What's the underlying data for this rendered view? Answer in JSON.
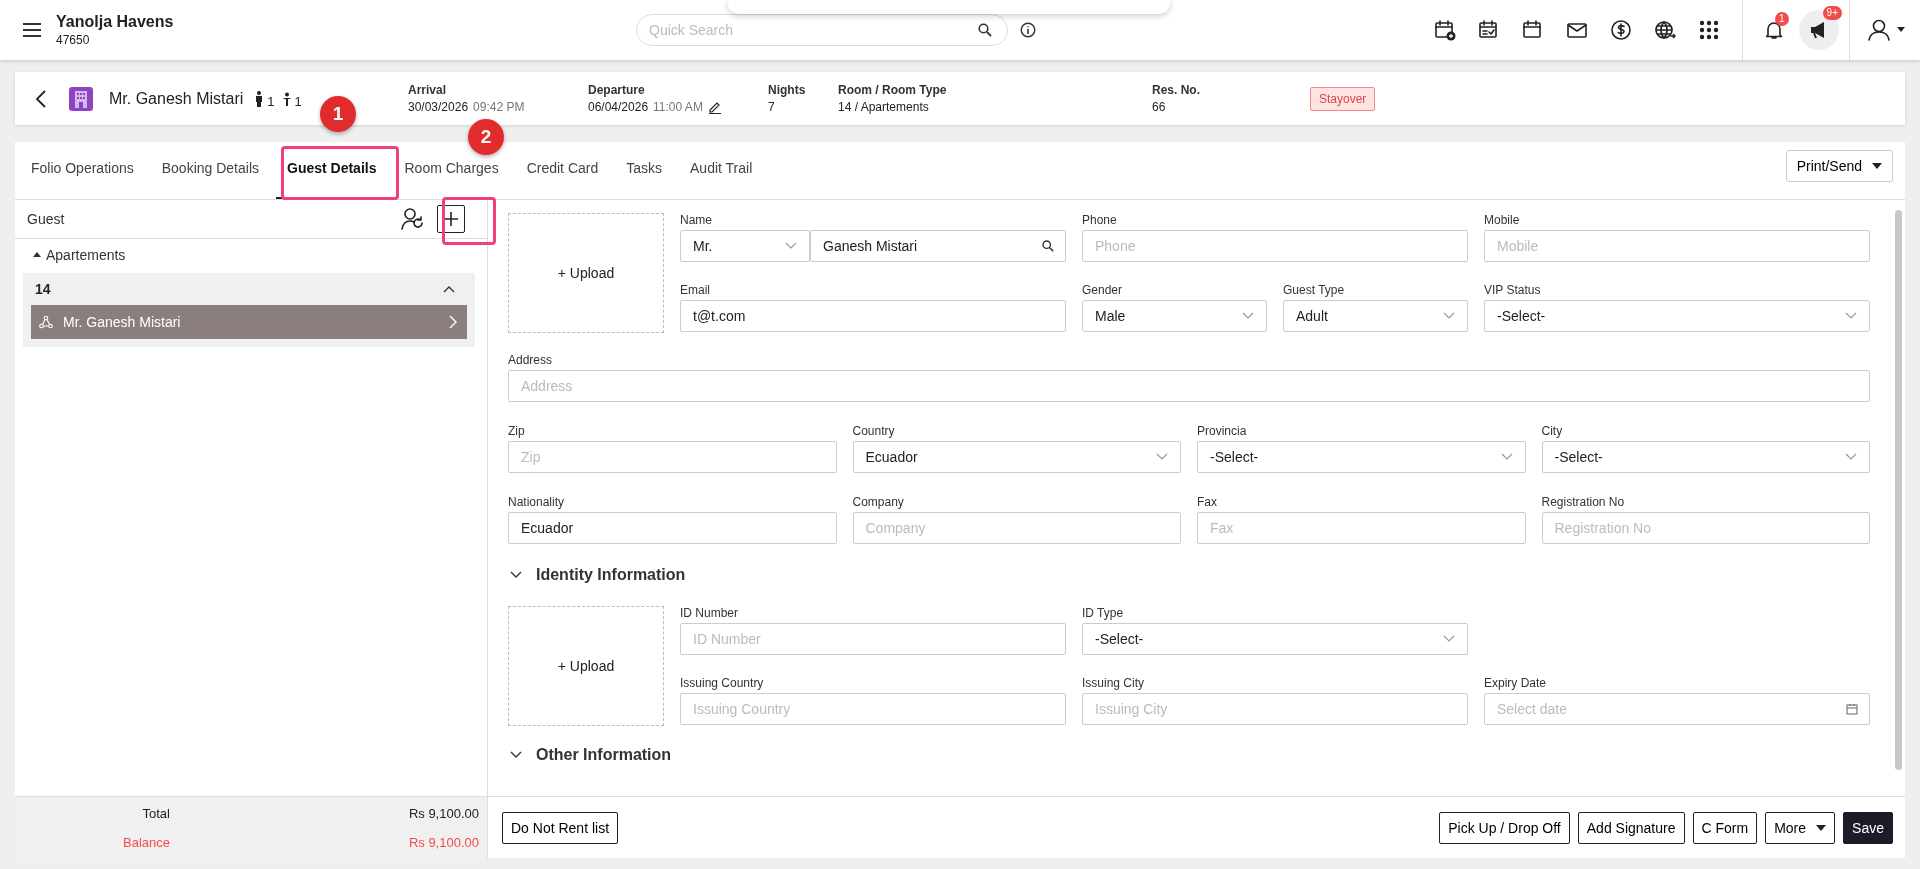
{
  "app": {
    "property": "Yanolja Havens",
    "code": "47650",
    "search_placeholder": "Quick Search",
    "notification_count": "1",
    "announcement_count": "9+"
  },
  "reservation": {
    "guest": "Mr. Ganesh Mistari",
    "adults": "1",
    "children": "1",
    "details": [
      {
        "label": "Arrival",
        "value": "30/03/2026",
        "time": "09:42 PM",
        "editable": false
      },
      {
        "label": "Departure",
        "value": "06/04/2026",
        "time": "11:00 AM",
        "editable": true
      },
      {
        "label": "Nights",
        "value": "7",
        "editable": false
      },
      {
        "label": "Room / Room Type",
        "value": "14 / Apartements",
        "editable": false
      },
      {
        "label": "Res. No.",
        "value": "66",
        "editable": false
      }
    ],
    "status": "Stayover"
  },
  "tabs": [
    {
      "label": "Folio Operations",
      "selected": false
    },
    {
      "label": "Booking Details",
      "selected": false
    },
    {
      "label": "Guest Details",
      "selected": true
    },
    {
      "label": "Room Charges",
      "selected": false
    },
    {
      "label": "Credit Card",
      "selected": false
    },
    {
      "label": "Tasks",
      "selected": false
    },
    {
      "label": "Audit Trail",
      "selected": false
    }
  ],
  "print_button": "Print/Send",
  "guest_panel": {
    "title": "Guest",
    "group": "Apartements",
    "expanded": true,
    "room": "14",
    "room_expanded": true,
    "guests": [
      {
        "name": "Mr. Ganesh Mistari",
        "selected": true
      }
    ]
  },
  "totals": [
    {
      "label": "Total",
      "value": "Rs 9,100.00",
      "kind": "normal"
    },
    {
      "label": "Balance",
      "value": "Rs 9,100.00",
      "kind": "due"
    }
  ],
  "guest_form": {
    "upload": "+ Upload",
    "top_rows": [
      [
        {
          "label": "Name",
          "kind": "name",
          "title": "Mr.",
          "value": "Ganesh Mistari"
        },
        {
          "label": "Phone",
          "kind": "text",
          "placeholder": "Phone"
        },
        {
          "label": "Mobile",
          "kind": "text",
          "placeholder": "Mobile"
        }
      ],
      [
        {
          "label": "Email",
          "kind": "text",
          "value": "t@t.com"
        },
        {
          "label": "Gender",
          "kind": "select",
          "value": "Male"
        },
        {
          "label": "Guest Type",
          "kind": "select",
          "value": "Adult"
        },
        {
          "label": "VIP Status",
          "kind": "select",
          "value": "-Select-"
        }
      ]
    ],
    "rows": [
      [
        {
          "label": "Address",
          "kind": "text",
          "placeholder": "Address"
        }
      ],
      [
        {
          "label": "Zip",
          "kind": "text",
          "placeholder": "Zip"
        },
        {
          "label": "Country",
          "kind": "select",
          "value": "Ecuador"
        },
        {
          "label": "Provincia",
          "kind": "select",
          "value": "-Select-"
        },
        {
          "label": "City",
          "kind": "select",
          "value": "-Select-"
        }
      ],
      [
        {
          "label": "Nationality",
          "kind": "text",
          "value": "Ecuador"
        },
        {
          "label": "Company",
          "kind": "text",
          "placeholder": "Company"
        },
        {
          "label": "Fax",
          "kind": "text",
          "placeholder": "Fax"
        },
        {
          "label": "Registration No",
          "kind": "text",
          "placeholder": "Registration No"
        }
      ]
    ]
  },
  "sections": [
    {
      "title": "Identity Information",
      "expanded": true,
      "upload": "+ Upload",
      "rows": [
        [
          {
            "label": "ID Number",
            "kind": "text",
            "placeholder": "ID Number"
          },
          {
            "label": "ID Type",
            "kind": "select",
            "value": "-Select-"
          }
        ],
        [
          {
            "label": "Issuing Country",
            "kind": "text",
            "placeholder": "Issuing Country"
          },
          {
            "label": "Issuing City",
            "kind": "text",
            "placeholder": "Issuing City"
          },
          {
            "label": "Expiry Date",
            "kind": "date",
            "placeholder": "Select date"
          }
        ]
      ]
    },
    {
      "title": "Other Information",
      "expanded": true
    }
  ],
  "left_buttons": [
    "Do Not Rent list"
  ],
  "right_buttons": [
    {
      "label": "Pick Up / Drop Off",
      "kind": "outline"
    },
    {
      "label": "Add Signature",
      "kind": "outline"
    },
    {
      "label": "C Form",
      "kind": "outline"
    },
    {
      "label": "More",
      "kind": "menu"
    },
    {
      "label": "Save",
      "kind": "primary"
    }
  ],
  "annotations": [
    {
      "number": "1"
    },
    {
      "number": "2"
    }
  ]
}
